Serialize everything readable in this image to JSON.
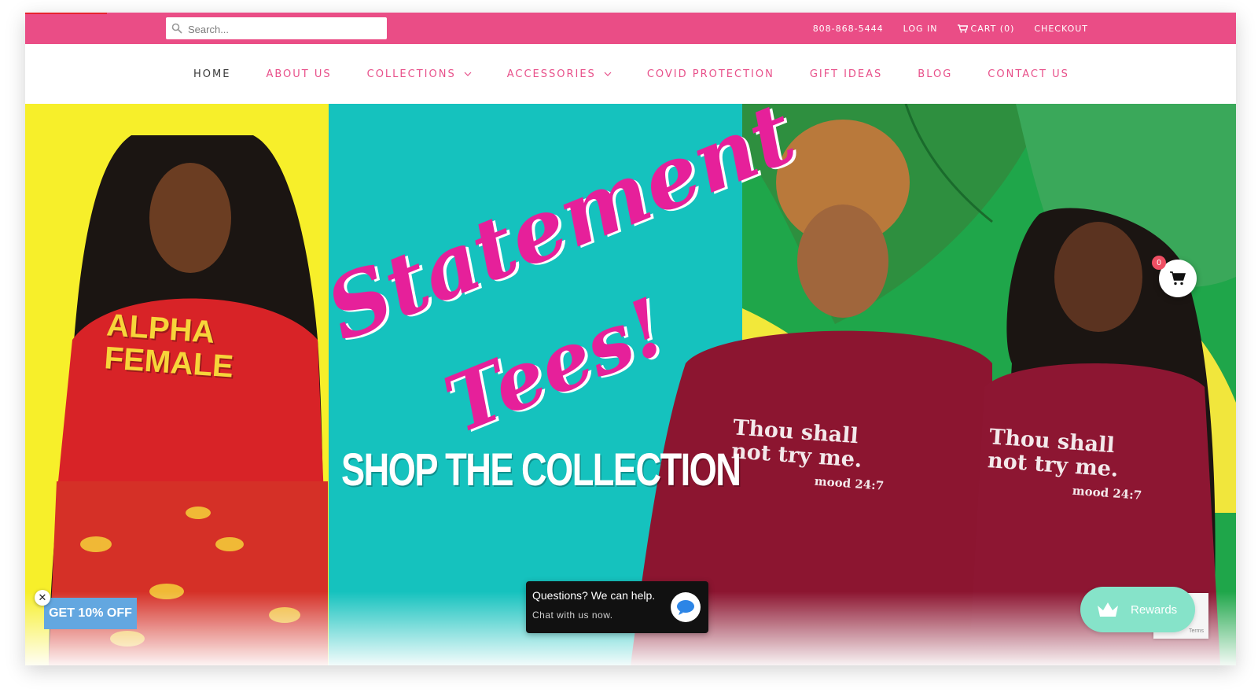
{
  "topbar": {
    "search_placeholder": "Search...",
    "phone": "808-868-5444",
    "login": "LOG IN",
    "cart": "CART (0)",
    "checkout": "CHECKOUT"
  },
  "nav": {
    "home": "HOME",
    "about": "ABOUT US",
    "collections": "COLLECTIONS",
    "accessories": "ACCESSORIES",
    "covid": "COVID PROTECTION",
    "gift": "GIFT IDEAS",
    "blog": "BLOG",
    "contact": "CONTACT US"
  },
  "hero": {
    "script_line1": "Statement",
    "script_line2": "Tees!",
    "headline": "SHOP THE COLLECTION",
    "shirt_left_line1": "ALPHA",
    "shirt_left_line2": "FEMALE",
    "shirt_right_line1": "Thou shall",
    "shirt_right_line2": "not try me.",
    "shirt_right_line3": "mood 24:7"
  },
  "float_cart": {
    "count": "0"
  },
  "promo": {
    "label": "GET 10% OFF",
    "close": "✕"
  },
  "chat": {
    "title": "Questions? We can help.",
    "subtitle": "Chat with us now."
  },
  "rewards": {
    "label": "Rewards"
  },
  "recaptcha": {
    "text": "Terms"
  },
  "colors": {
    "brand_pink": "#ea4d86",
    "nav_pink": "#e8508a",
    "teal": "#15c2be",
    "yellow": "#f7ef2a",
    "rewards_mint": "#86e3c9"
  }
}
